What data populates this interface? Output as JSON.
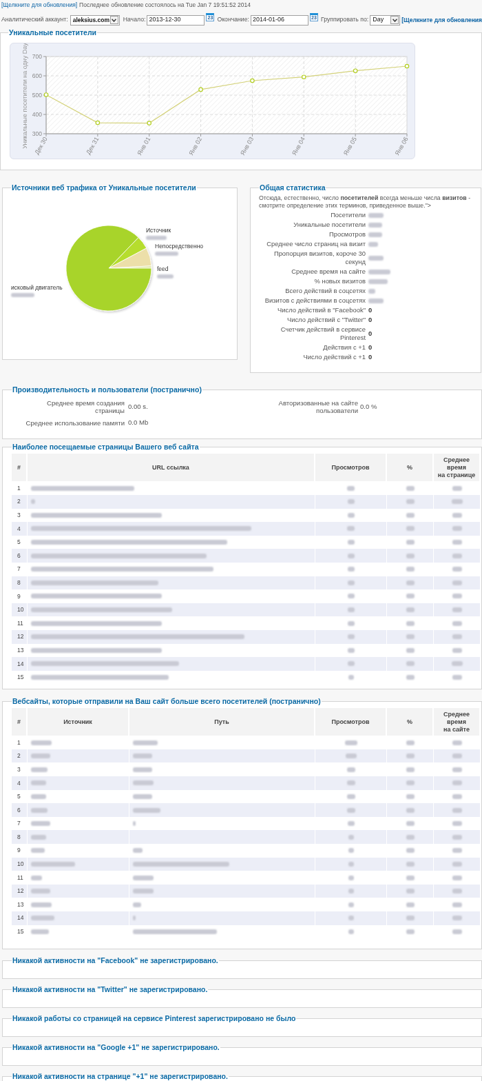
{
  "header": {
    "refresh_link": "[Щелкните для обновления]",
    "last_update": "Последнее обновление состоялось на Tue Jan 7 19:51:52 2014"
  },
  "filters": {
    "account": {
      "label": "Аналитический аккаунт:",
      "value": "aleksius.com"
    },
    "start": {
      "label": "Начало:",
      "value": "2013-12-30",
      "calendar": "23"
    },
    "end": {
      "label": "Окончание:",
      "value": "2014-01-06",
      "calendar": "23"
    },
    "group_by": {
      "label": "Группировать по:",
      "value": "Day"
    },
    "refresh_link": "[Щелкните для обновления"
  },
  "unique_visitors": {
    "title": "Уникальные посетители",
    "chart_data": {
      "type": "line",
      "ylabel": "Уникальные посетители на одну Day",
      "categories": [
        "Дек 30",
        "Дек 31",
        "Янв 01",
        "Янв 02",
        "Янв 03",
        "Янв 04",
        "Янв 05",
        "Янв 06"
      ],
      "values": [
        502,
        357,
        355,
        529,
        575,
        594,
        626,
        650
      ],
      "ylim": [
        300,
        700
      ],
      "yticks": [
        300,
        400,
        500,
        600,
        700
      ],
      "grid": true,
      "marker": true
    }
  },
  "traffic_sources": {
    "title": "Источники веб трафика от Уникальные посетители",
    "slices": [
      {
        "label": "Источник",
        "color": "#b6dd2e"
      },
      {
        "label": "Непосредственно",
        "color": "#ecdfa9"
      },
      {
        "label": "feed",
        "color": "#dfe6a0"
      },
      {
        "label": "исковый двигатель",
        "color": "#a8d42a"
      }
    ]
  },
  "general_stats": {
    "title": "Общая статистика",
    "intro": "Отсюда, естественно, число **посетителей** всегда меньше числа **визитов** - смотрите определение этих терминов, приведенное выше.\">",
    "rows": [
      {
        "label": "Посетители",
        "kind": "blurred"
      },
      {
        "label": "Уникальные посетители",
        "kind": "blurred"
      },
      {
        "label": "Просмотров",
        "kind": "blurred"
      },
      {
        "label": "Среднее число страниц на визит",
        "kind": "blurred"
      },
      {
        "label": "Пропорция визитов, короче 30 секунд",
        "kind": "blurred"
      },
      {
        "label": "Среднее время на сайте",
        "kind": "blurred"
      },
      {
        "label": "% новых визитов",
        "kind": "blurred"
      },
      {
        "label": "Всего действий в соцсетях",
        "kind": "blurred"
      },
      {
        "label": "Визитов с действиями в соцсетях",
        "kind": "blurred"
      },
      {
        "label": "Число действий в \"Facebook\"",
        "kind": "value",
        "value": "0"
      },
      {
        "label": "Число действий с \"Twitter\"",
        "kind": "value",
        "value": "0"
      },
      {
        "label": "Счетчик действий в сервисе Pinterest",
        "kind": "value",
        "value": "0"
      },
      {
        "label": "Действия с +1",
        "kind": "value",
        "value": "0"
      },
      {
        "label": "Число действий с +1",
        "kind": "value",
        "value": "0"
      }
    ]
  },
  "performance": {
    "title": "Производительность и пользователи (постранично)",
    "columns": [
      [
        {
          "label": "Среднее время создания страницы",
          "value": "0.00 s."
        },
        {
          "label": "Среднее использование памяти",
          "value": "0.0 Mb"
        }
      ],
      [
        {
          "label": "Авторизованные на сайте пользователи",
          "value": "0.0 %"
        }
      ]
    ]
  },
  "top_pages": {
    "title": "Наиболее посещаемые страницы Вашего веб сайта",
    "columns": [
      "#",
      "URL ссылка",
      "Просмотров",
      "%",
      "Среднее\nвремя\nна странице"
    ],
    "rows": [
      {
        "number": "1"
      },
      {
        "number": "2"
      },
      {
        "number": "3"
      },
      {
        "number": "4"
      },
      {
        "number": "5"
      },
      {
        "number": "6"
      },
      {
        "number": "7"
      },
      {
        "number": "8"
      },
      {
        "number": "9"
      },
      {
        "number": "10"
      },
      {
        "number": "11"
      },
      {
        "number": "12"
      },
      {
        "number": "13"
      },
      {
        "number": "14"
      },
      {
        "number": "15"
      }
    ]
  },
  "referrers": {
    "title": "Вебсайты, которые отправили на Ваш сайт больше всего посетителей (постранично)",
    "columns": [
      "#",
      "Источник",
      "Путь",
      "Просмотров",
      "%",
      "Среднее\nвремя\nна сайте"
    ],
    "rows": [
      {
        "number": "1"
      },
      {
        "number": "2"
      },
      {
        "number": "3"
      },
      {
        "number": "4"
      },
      {
        "number": "5"
      },
      {
        "number": "6"
      },
      {
        "number": "7"
      },
      {
        "number": "8"
      },
      {
        "number": "9"
      },
      {
        "number": "10"
      },
      {
        "number": "11"
      },
      {
        "number": "12"
      },
      {
        "number": "13"
      },
      {
        "number": "14"
      },
      {
        "number": "15"
      }
    ]
  },
  "social_sections": [
    {
      "title": "Никакой активности на \"Facebook\" не зарегистрировано."
    },
    {
      "title": "Никакой активности на \"Twitter\" не зарегистрировано."
    },
    {
      "title": "Никакой работы со страницей на сервисе Pinterest зарегистрировано не было"
    },
    {
      "title": "Никакой активности на \"Google +1\" не зарегистрировано."
    },
    {
      "title": "Никакой активности на странице \"+1\" не зарегистрировано."
    }
  ]
}
